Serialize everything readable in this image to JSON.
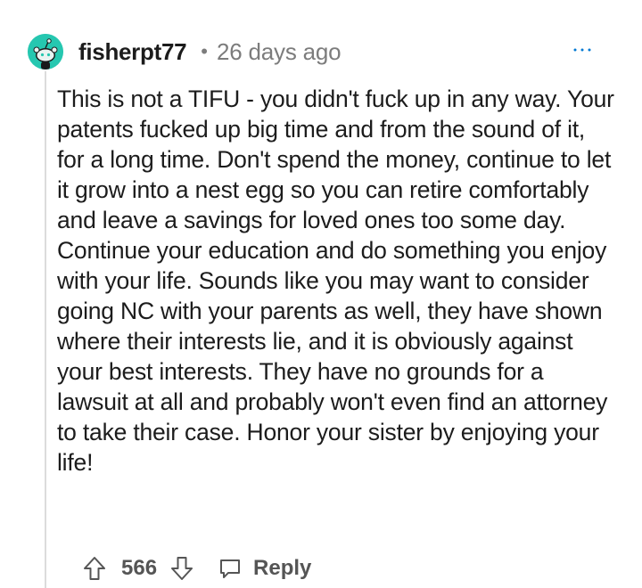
{
  "comment": {
    "username": "fisherpt77",
    "separator": "•",
    "timestamp": "26 days ago",
    "more_icon": "more-options-icon",
    "body": "This is not a TIFU - you didn't fuck up in any way. Your patents fucked up big time and from the sound of it, for a long time. Don't spend the money, continue to let it grow into a nest egg so you can retire comfortably and leave a savings for loved ones too some day. Continue your education and do something you enjoy with your life. Sounds like you may want to consider going NC with your parents as well, they have shown where their interests lie, and it is obviously against your best interests. They have no grounds for a lawsuit at all and probably won't even find an attorney to take their case. Honor your sister by enjoying your life!",
    "score": "566",
    "reply_label": "Reply"
  },
  "colors": {
    "avatar_bg": "#26c7b0",
    "accent_blue": "#0079d3",
    "muted": "#7c7c7c"
  }
}
